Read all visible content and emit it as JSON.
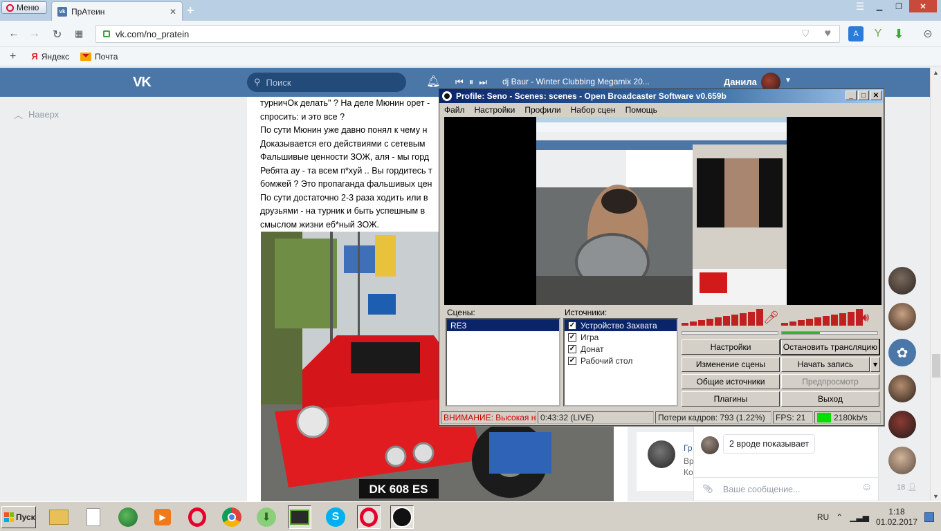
{
  "browser": {
    "menu_label": "Меню",
    "tab_title": "ПрАтеин",
    "url": "vk.com/no_pratein",
    "bookmarks": [
      {
        "label": "Яндекс",
        "icon": "yandex-icon"
      },
      {
        "label": "Почта",
        "icon": "mail-icon"
      }
    ]
  },
  "vk": {
    "search_placeholder": "Поиск",
    "track": "dj Baur - Winter Clubbing Megamix 20...",
    "user_name": "Данила",
    "back_to_top": "Наверх",
    "post_lines": [
      "турничОк делать\" ? На деле Мюнин орет -",
      "спросить: и это все ?",
      "По сути Мюнин уже давно понял к чему н",
      "Доказывается его действиями с сетевым",
      "Фальшивые ценности ЗОЖ, аля - мы горд",
      "Ребята ау - та всем п*хуй .. Вы гордитесь т",
      "бомжей ? Это пропаганда фальшивых цен",
      "По сути достаточно 2-3 раза ходить или в",
      "друзьями - на турник и быть успешным в",
      "смыслом жизни еб*ный ЗОЖ."
    ],
    "plate": "DK 608 ES",
    "post_card": {
      "author": "Гр",
      "line2": "Вр",
      "line3": "Ко"
    },
    "chat_message": "2 вроде показывает",
    "chat_placeholder": "Ваше сообщение...",
    "friends_count": "18"
  },
  "obs": {
    "title": "Profile: Seno - Scenes: scenes - Open Broadcaster Software v0.659b",
    "menu": [
      "Файл",
      "Настройки",
      "Профили",
      "Набор сцен",
      "Помощь"
    ],
    "scenes_label": "Сцены:",
    "scenes": [
      "RE3"
    ],
    "sources_label": "Источники:",
    "sources": [
      {
        "label": "Устройство Захвата",
        "checked": true,
        "selected": true
      },
      {
        "label": "Игра",
        "checked": true,
        "selected": false
      },
      {
        "label": "Донат",
        "checked": true,
        "selected": false
      },
      {
        "label": "Рабочий стол",
        "checked": true,
        "selected": false
      }
    ],
    "buttons": {
      "settings": "Настройки",
      "stop_stream": "Остановить трансляцию",
      "edit_scene": "Изменение сцены",
      "start_record": "Начать запись",
      "global_sources": "Общие источники",
      "preview": "Предпросмотр",
      "plugins": "Плагины",
      "exit": "Выход"
    },
    "status": {
      "warning": "ВНИМАНИЕ: Высокая нагр",
      "time": "0:43:32 (LIVE)",
      "dropped": "Потери кадров: 793 (1.22%)",
      "fps": "FPS: 21",
      "bitrate": "2180kb/s"
    },
    "colors": {
      "meter": "#c02020",
      "bitrate_ok": "#00e000",
      "warning": "#d00000"
    }
  },
  "taskbar": {
    "start_label": "Пуск",
    "lang": "RU",
    "time": "1:18",
    "date": "01.02.2017"
  }
}
